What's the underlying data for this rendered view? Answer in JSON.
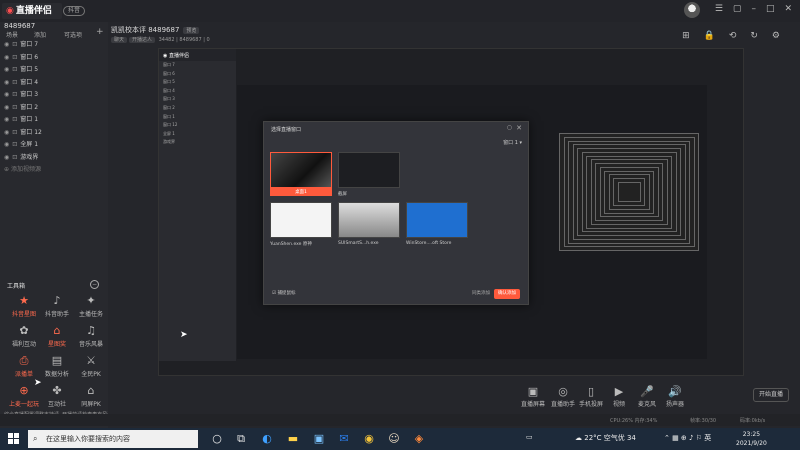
{
  "app": {
    "brand": "直播伴侣",
    "version": "抖音",
    "user_id": "8489687",
    "room_title": "凯凯校本评 8489687",
    "room_tag": "预览",
    "room_chips": [
      "聊天",
      "开播达人"
    ],
    "room_meta": "34482 | 8489687 | 0"
  },
  "left_tabs": {
    "scenes": "场景",
    "sources": "添加",
    "common": "可选项"
  },
  "scenes": [
    {
      "name": "窗口 7"
    },
    {
      "name": "窗口 6"
    },
    {
      "name": "窗口 5"
    },
    {
      "name": "窗口 4"
    },
    {
      "name": "窗口 3"
    },
    {
      "name": "窗口 2"
    },
    {
      "name": "窗口 1"
    },
    {
      "name": "窗口 12"
    },
    {
      "name": "全屏 1"
    },
    {
      "name": "游戏界"
    }
  ],
  "add_scene": "添加视频源",
  "tools": {
    "header": "工具箱",
    "items": [
      {
        "label": "抖音星图",
        "icon": "★",
        "red": true
      },
      {
        "label": "抖音助手",
        "icon": "♪",
        "red": false
      },
      {
        "label": "主播任务",
        "icon": "✦",
        "red": false
      },
      {
        "label": "福利互动",
        "icon": "✿",
        "red": false
      },
      {
        "label": "星图奖",
        "icon": "⌂",
        "red": true
      },
      {
        "label": "音乐风暴",
        "icon": "♫",
        "red": false
      },
      {
        "label": "派播单",
        "icon": "⎙",
        "red": true
      },
      {
        "label": "数据分析",
        "icon": "▤",
        "red": false
      },
      {
        "label": "全民PK",
        "icon": "⚔",
        "red": false
      },
      {
        "label": "上麦一起玩",
        "icon": "⊕",
        "red": true
      },
      {
        "label": "互动社",
        "icon": "✤",
        "red": false
      },
      {
        "label": "同屏PK",
        "icon": "⌂",
        "red": false
      }
    ]
  },
  "notice": "综合直播配置调整支持请,  开播前请检查麦克风设置,  每周五有大福利",
  "modal": {
    "title": "选择直播窗口",
    "select": "窗口 1",
    "thumbs": [
      {
        "label": "桌面1",
        "selected": true
      },
      {
        "label": "截屏",
        "selected": false
      },
      {
        "label": "YuanShen.exe   原神",
        "selected": false
      },
      {
        "label": "SUISmartS...h.exe",
        "selected": false
      },
      {
        "label": "WinStore....oft Store",
        "selected": false
      }
    ],
    "checkbox": "捕捉鼠标",
    "cancel": "同类添加",
    "ok": "确认添加"
  },
  "controls": [
    {
      "label": "直播屏幕",
      "icon": "▣"
    },
    {
      "label": "直播助手",
      "icon": "◎"
    },
    {
      "label": "手机投屏",
      "icon": "▯"
    },
    {
      "label": "视频",
      "icon": "▶"
    },
    {
      "label": "麦克风",
      "icon": "🎤"
    },
    {
      "label": "扬声器",
      "icon": "🔊"
    }
  ],
  "start_live": "开始直播",
  "status": {
    "left": "CPU:26%  内存:34%",
    "mid": "帧率:30/30",
    "right": "码率:0kb/s"
  },
  "taskbar": {
    "search_placeholder": "在这里输入你要搜索的内容",
    "weather": "22°C 空气优 34",
    "time": "23:25",
    "date": "2021/9/20"
  }
}
